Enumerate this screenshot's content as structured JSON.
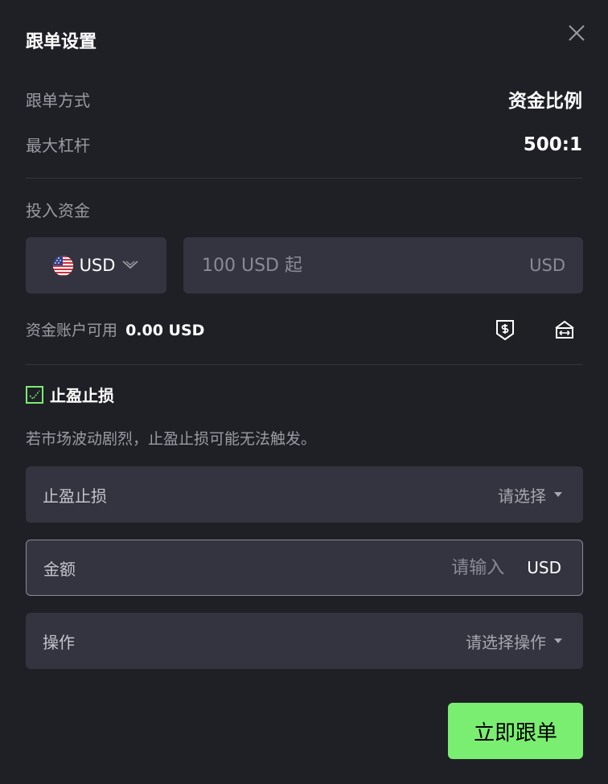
{
  "dialog": {
    "title": "跟单设置",
    "close_icon": "close-icon"
  },
  "info": {
    "mode_label": "跟单方式",
    "mode_value": "资金比例",
    "leverage_label": "最大杠杆",
    "leverage_value": "500:1"
  },
  "investment": {
    "label": "投入资金",
    "currency": "USD",
    "currency_icon": "us-flag-icon",
    "amount_value": "",
    "amount_placeholder": "100 USD 起",
    "amount_unit": "USD",
    "available_label": "资金账户可用",
    "available_value": "0.00 USD",
    "deposit_icon": "dollar-shield-icon",
    "transfer_icon": "transfer-icon"
  },
  "tpsl": {
    "checkbox_label": "止盈止损",
    "checked": true,
    "warning": "若市场波动剧烈，止盈止损可能无法触发。",
    "type_label": "止盈止损",
    "type_placeholder": "请选择",
    "amount_label": "金额",
    "amount_value": "",
    "amount_placeholder": "请输入",
    "amount_unit": "USD",
    "action_label": "操作",
    "action_placeholder": "请选择操作"
  },
  "submit_label": "立即跟单",
  "colors": {
    "background": "#1f2026",
    "field": "#33343f",
    "accent": "#7aee70",
    "muted_text": "#9a9ba3"
  }
}
